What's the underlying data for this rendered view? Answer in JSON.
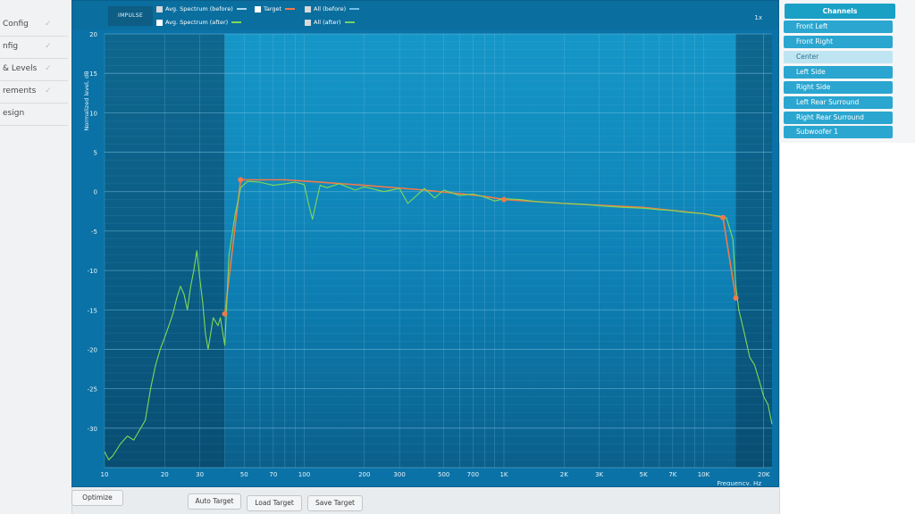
{
  "sidebar": {
    "items": [
      {
        "label": "Config"
      },
      {
        "label": "nfig"
      },
      {
        "label": "& Levels"
      },
      {
        "label": "rements"
      },
      {
        "label": "esign"
      }
    ]
  },
  "main": {
    "impulse_tab": "IMPULSE",
    "zoom": "1x",
    "legend": [
      {
        "label": "Avg. Spectrum (before)",
        "checked": false,
        "color": "#a7d7ee"
      },
      {
        "label": "Avg. Spectrum (after)",
        "checked": true,
        "color": "#7fd957"
      },
      {
        "label": "Target",
        "checked": true,
        "color": "#f07a4a"
      },
      {
        "label": "All (before)",
        "checked": false,
        "color": "#6fbfe6"
      },
      {
        "label": "All (after)",
        "checked": false,
        "color": "#72d46a"
      }
    ]
  },
  "channels": {
    "header": "Channels",
    "items": [
      {
        "label": "Front Left"
      },
      {
        "label": "Front Right"
      },
      {
        "label": "Center"
      },
      {
        "label": "Left Side"
      },
      {
        "label": "Right Side"
      },
      {
        "label": "Left Rear Surround"
      },
      {
        "label": "Right Rear Surround"
      },
      {
        "label": "Subwoofer 1"
      }
    ],
    "selected": "Center"
  },
  "buttons": {
    "optimize": "Optimize",
    "auto_target": "Auto Target",
    "load_target": "Load Target",
    "save_target": "Save Target"
  },
  "chart_data": {
    "type": "line",
    "xlabel": "Frequency, Hz",
    "ylabel": "Normalized level, dB",
    "xscale": "log",
    "xlim": [
      10,
      22000
    ],
    "ylim": [
      -35,
      20
    ],
    "grid": true,
    "legend_placement": "top",
    "x_ticks": [
      10,
      20,
      30,
      50,
      70,
      100,
      200,
      300,
      500,
      700,
      1000,
      2000,
      3000,
      5000,
      7000,
      10000,
      20000
    ],
    "x_tick_labels": [
      "10",
      "20",
      "30",
      "50",
      "70",
      "100",
      "200",
      "300",
      "500",
      "700",
      "1K",
      "2K",
      "3K",
      "5K",
      "7K",
      "10K",
      "20K"
    ],
    "y_ticks": [
      20,
      15,
      10,
      5,
      0,
      -5,
      -10,
      -15,
      -20,
      -25,
      -30
    ],
    "y_tick_labels": [
      "20",
      "15",
      "10",
      "5",
      "0",
      "-5",
      "-10",
      "-15",
      "-20",
      "-25",
      "-30"
    ],
    "shaded_regions": [
      {
        "from": 10,
        "to": 40
      },
      {
        "from": 14500,
        "to": 22000
      }
    ],
    "series": [
      {
        "name": "Target",
        "color": "#f07a4a",
        "x": [
          40,
          48,
          60,
          80,
          120,
          200,
          400,
          800,
          1000,
          2000,
          5000,
          10000,
          12500,
          14500
        ],
        "y": [
          -15.5,
          1.5,
          1.5,
          1.5,
          1.2,
          0.8,
          0.2,
          -0.6,
          -1.0,
          -1.5,
          -2.0,
          -2.8,
          -3.3,
          -13.5
        ]
      },
      {
        "name": "Avg. Spectrum (after)",
        "color": "#7fd957",
        "x": [
          10,
          10.5,
          11,
          12,
          13,
          14,
          16,
          17,
          18,
          19,
          20,
          21,
          22,
          23,
          24,
          25,
          26,
          27,
          28,
          29,
          30,
          31,
          32,
          33,
          35,
          37,
          38,
          40,
          42,
          45,
          48,
          52,
          60,
          70,
          80,
          90,
          100,
          105,
          110,
          115,
          120,
          130,
          150,
          180,
          200,
          250,
          300,
          330,
          400,
          450,
          500,
          600,
          700,
          800,
          900,
          1000,
          1200,
          1500,
          2000,
          2500,
          3000,
          4000,
          5000,
          6000,
          7000,
          8000,
          10000,
          12000,
          13000,
          14000,
          14500,
          15000,
          15500,
          16000,
          16500,
          17000,
          18000,
          19000,
          20000,
          21000,
          22000
        ],
        "y": [
          -33,
          -34,
          -33.5,
          -32,
          -31,
          -31.5,
          -29,
          -25,
          -22,
          -20,
          -18.5,
          -17,
          -15.5,
          -13.5,
          -12,
          -13,
          -15,
          -12,
          -10,
          -7.5,
          -11,
          -14,
          -18,
          -20,
          -16,
          -17,
          -16,
          -19.5,
          -8,
          -3,
          0.5,
          1.3,
          1.2,
          0.8,
          1.0,
          1.2,
          0.9,
          -1.5,
          -3.5,
          -1.2,
          0.8,
          0.5,
          1.0,
          0.2,
          0.6,
          0.0,
          0.4,
          -1.5,
          0.4,
          -0.8,
          0.2,
          -0.5,
          -0.3,
          -0.7,
          -1.2,
          -0.9,
          -1.0,
          -1.3,
          -1.5,
          -1.6,
          -1.8,
          -2.0,
          -2.1,
          -2.3,
          -2.4,
          -2.6,
          -2.8,
          -3.1,
          -3.3,
          -6,
          -12,
          -15,
          -16.5,
          -18,
          -19.5,
          -21,
          -22,
          -24,
          -26,
          -27,
          -29.5
        ]
      }
    ]
  }
}
